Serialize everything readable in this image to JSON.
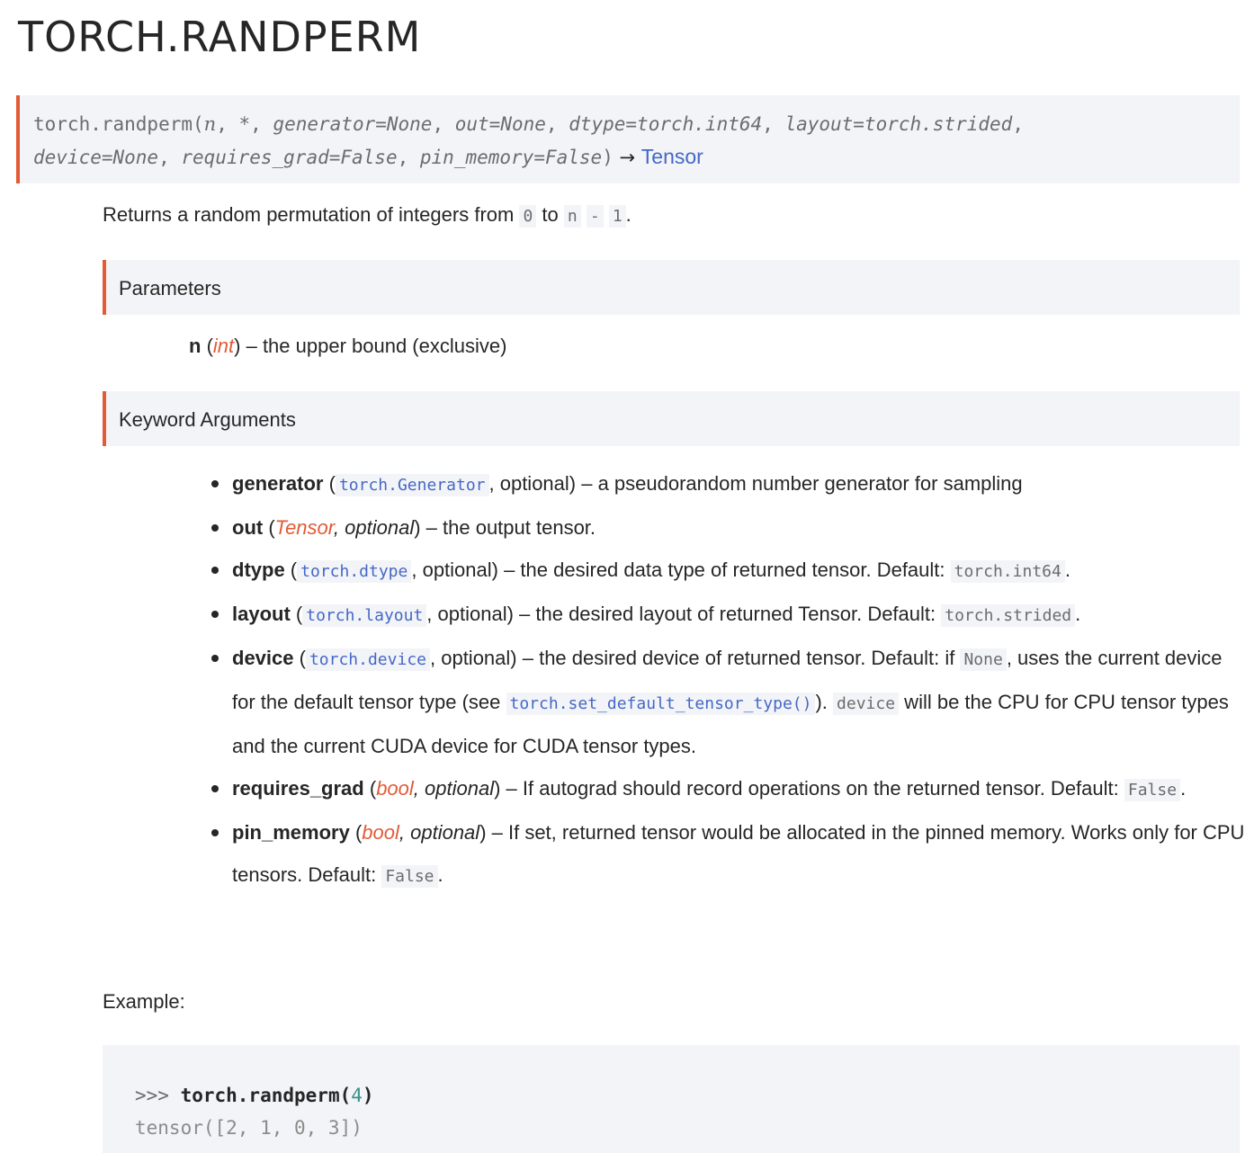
{
  "title": "TORCH.RANDPERM",
  "signature": {
    "func": "torch.randperm(",
    "p_n": "n",
    "sep1": ", ",
    "p_star": "*",
    "sep2": ", ",
    "p_generator": "generator=None",
    "sep3": ", ",
    "p_out": "out=None",
    "sep4": ", ",
    "p_dtype": "dtype=torch.int64",
    "sep5": ", ",
    "p_layout": "layout=torch.strided",
    "sep6": ",",
    "p_device": "device=None",
    "sep7": ", ",
    "p_requires_grad": "requires_grad=False",
    "sep8": ", ",
    "p_pin_memory": "pin_memory=False",
    "close": ")",
    "arrow": " → ",
    "return_type": "Tensor"
  },
  "description": {
    "prefix": "Returns a random permutation of integers from ",
    "code1": "0",
    "mid": " to ",
    "code2": "n",
    "code3": "-",
    "code4": "1",
    "suffix": "."
  },
  "parameters": {
    "heading": "Parameters",
    "name": "n",
    "open": " (",
    "type": "int",
    "close": ")",
    "desc": " – the upper bound (exclusive)"
  },
  "keyword_arguments": {
    "heading": "Keyword Arguments",
    "items": [
      {
        "name": "generator",
        "open": " (",
        "type": "torch.Generator",
        "after": ", optional) – a pseudorandom number generator for sampling"
      },
      {
        "name": "out",
        "open": " (",
        "type": "Tensor",
        "comma": ",",
        "opt": " optional",
        "close": ")",
        "desc": " – the output tensor."
      },
      {
        "name": "dtype",
        "open": " (",
        "type": "torch.dtype",
        "after": ", optional) – the desired data type of returned tensor. Default: ",
        "default": "torch.int64",
        "end": "."
      },
      {
        "name": "layout",
        "open": " (",
        "type": "torch.layout",
        "after": ", optional) – the desired layout of returned Tensor. Default: ",
        "default": "torch.strided",
        "end": "."
      },
      {
        "name": "device",
        "open": " (",
        "type": "torch.device",
        "after": ", optional) – the desired device of returned tensor. Default: if ",
        "code1": "None",
        "mid1": ", uses the current device for the default tensor type (see ",
        "link": "torch.set_default_tensor_type()",
        "mid2": "). ",
        "code2": "device",
        "end": " will be the CPU for CPU tensor types and the current CUDA device for CUDA tensor types."
      },
      {
        "name": "requires_grad",
        "open": " (",
        "type": "bool",
        "comma": ",",
        "opt": " optional",
        "close": ")",
        "desc": " – If autograd should record operations on the returned tensor. Default: ",
        "default": "False",
        "end": "."
      },
      {
        "name": "pin_memory",
        "open": " (",
        "type": "bool",
        "comma": ",",
        "opt": " optional",
        "close": ")",
        "desc": " – If set, returned tensor would be allocated in the pinned memory. Works only for CPU tensors. Default: ",
        "default": "False",
        "end": "."
      }
    ]
  },
  "example": {
    "label": "Example:",
    "prompt": ">>> ",
    "call": "torch.randperm(",
    "arg": "4",
    "call_close": ")",
    "output": "tensor([2, 1, 0, 3])"
  }
}
